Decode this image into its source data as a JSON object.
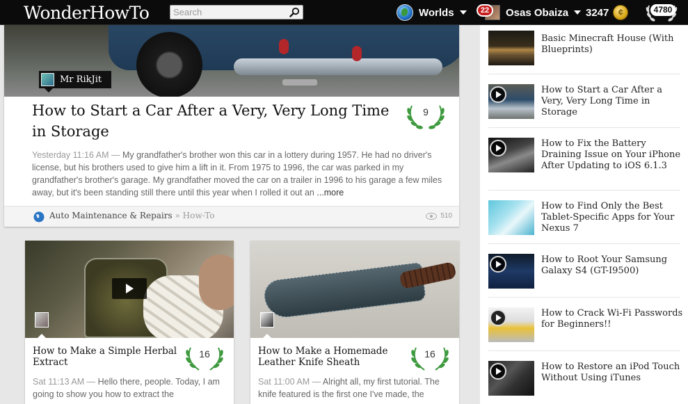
{
  "header": {
    "logo": "WonderHowTo",
    "search_placeholder": "Search",
    "worlds_label": "Worlds",
    "notifications": "22",
    "username": "Osas Obaiza",
    "points": "3247",
    "rank": "4780"
  },
  "featured": {
    "author": "Mr RikJit",
    "title": "How to Start a Car After a Very, Very Long Time in Storage",
    "date": "Yesterday 11:16 AM —",
    "excerpt": "My grandfather's brother won this car in a lottery during 1957. He had no driver's license, but his brothers used to give him a lift in it. From 1975 to 1996, the car was parked in my grandfather's brother's garage. My grandfather moved the car on a trailer in 1996 to his garage a few miles away, but it's been standing still there until this year when I rolled it out an",
    "more_label": "...more",
    "likes": "9",
    "category": "Auto Maintenance & Repairs",
    "subcategory": "» How-To",
    "views": "510"
  },
  "cards": [
    {
      "title": "How to Make a Simple Herbal Extract",
      "likes": "16",
      "date": "Sat 11:13 AM —",
      "excerpt": "Hello there, people. Today, I am going to show you how to extract the"
    },
    {
      "title": "How to Make a Homemade Leather Knife Sheath",
      "likes": "16",
      "date": "Sat 11:00 AM —",
      "excerpt": "Alright all, my first tutorial. The knife featured is the first one I've made, the"
    }
  ],
  "sidebar": {
    "items": [
      {
        "title": "Basic Minecraft House (With Blueprints)",
        "video": false
      },
      {
        "title": "How to Start a Car After a Very, Very Long Time in Storage",
        "video": true
      },
      {
        "title": "How to Fix the Battery Draining Issue on Your iPhone After Updating to iOS 6.1.3",
        "video": true
      },
      {
        "title": "How to Find Only the Best Tablet-Specific Apps for Your Nexus 7",
        "video": false
      },
      {
        "title": "How to Root Your Samsung Galaxy S4 (GT-I9500)",
        "video": true
      },
      {
        "title": "How to Crack Wi-Fi Passwords for Beginners!!",
        "video": true
      },
      {
        "title": "How to Restore an iPod Touch Without Using iTunes",
        "video": true
      }
    ]
  },
  "colors": {
    "topbar": "#0b0b0b",
    "laurel_green": "#3f9a3f",
    "badge_red": "#c81d1d"
  }
}
